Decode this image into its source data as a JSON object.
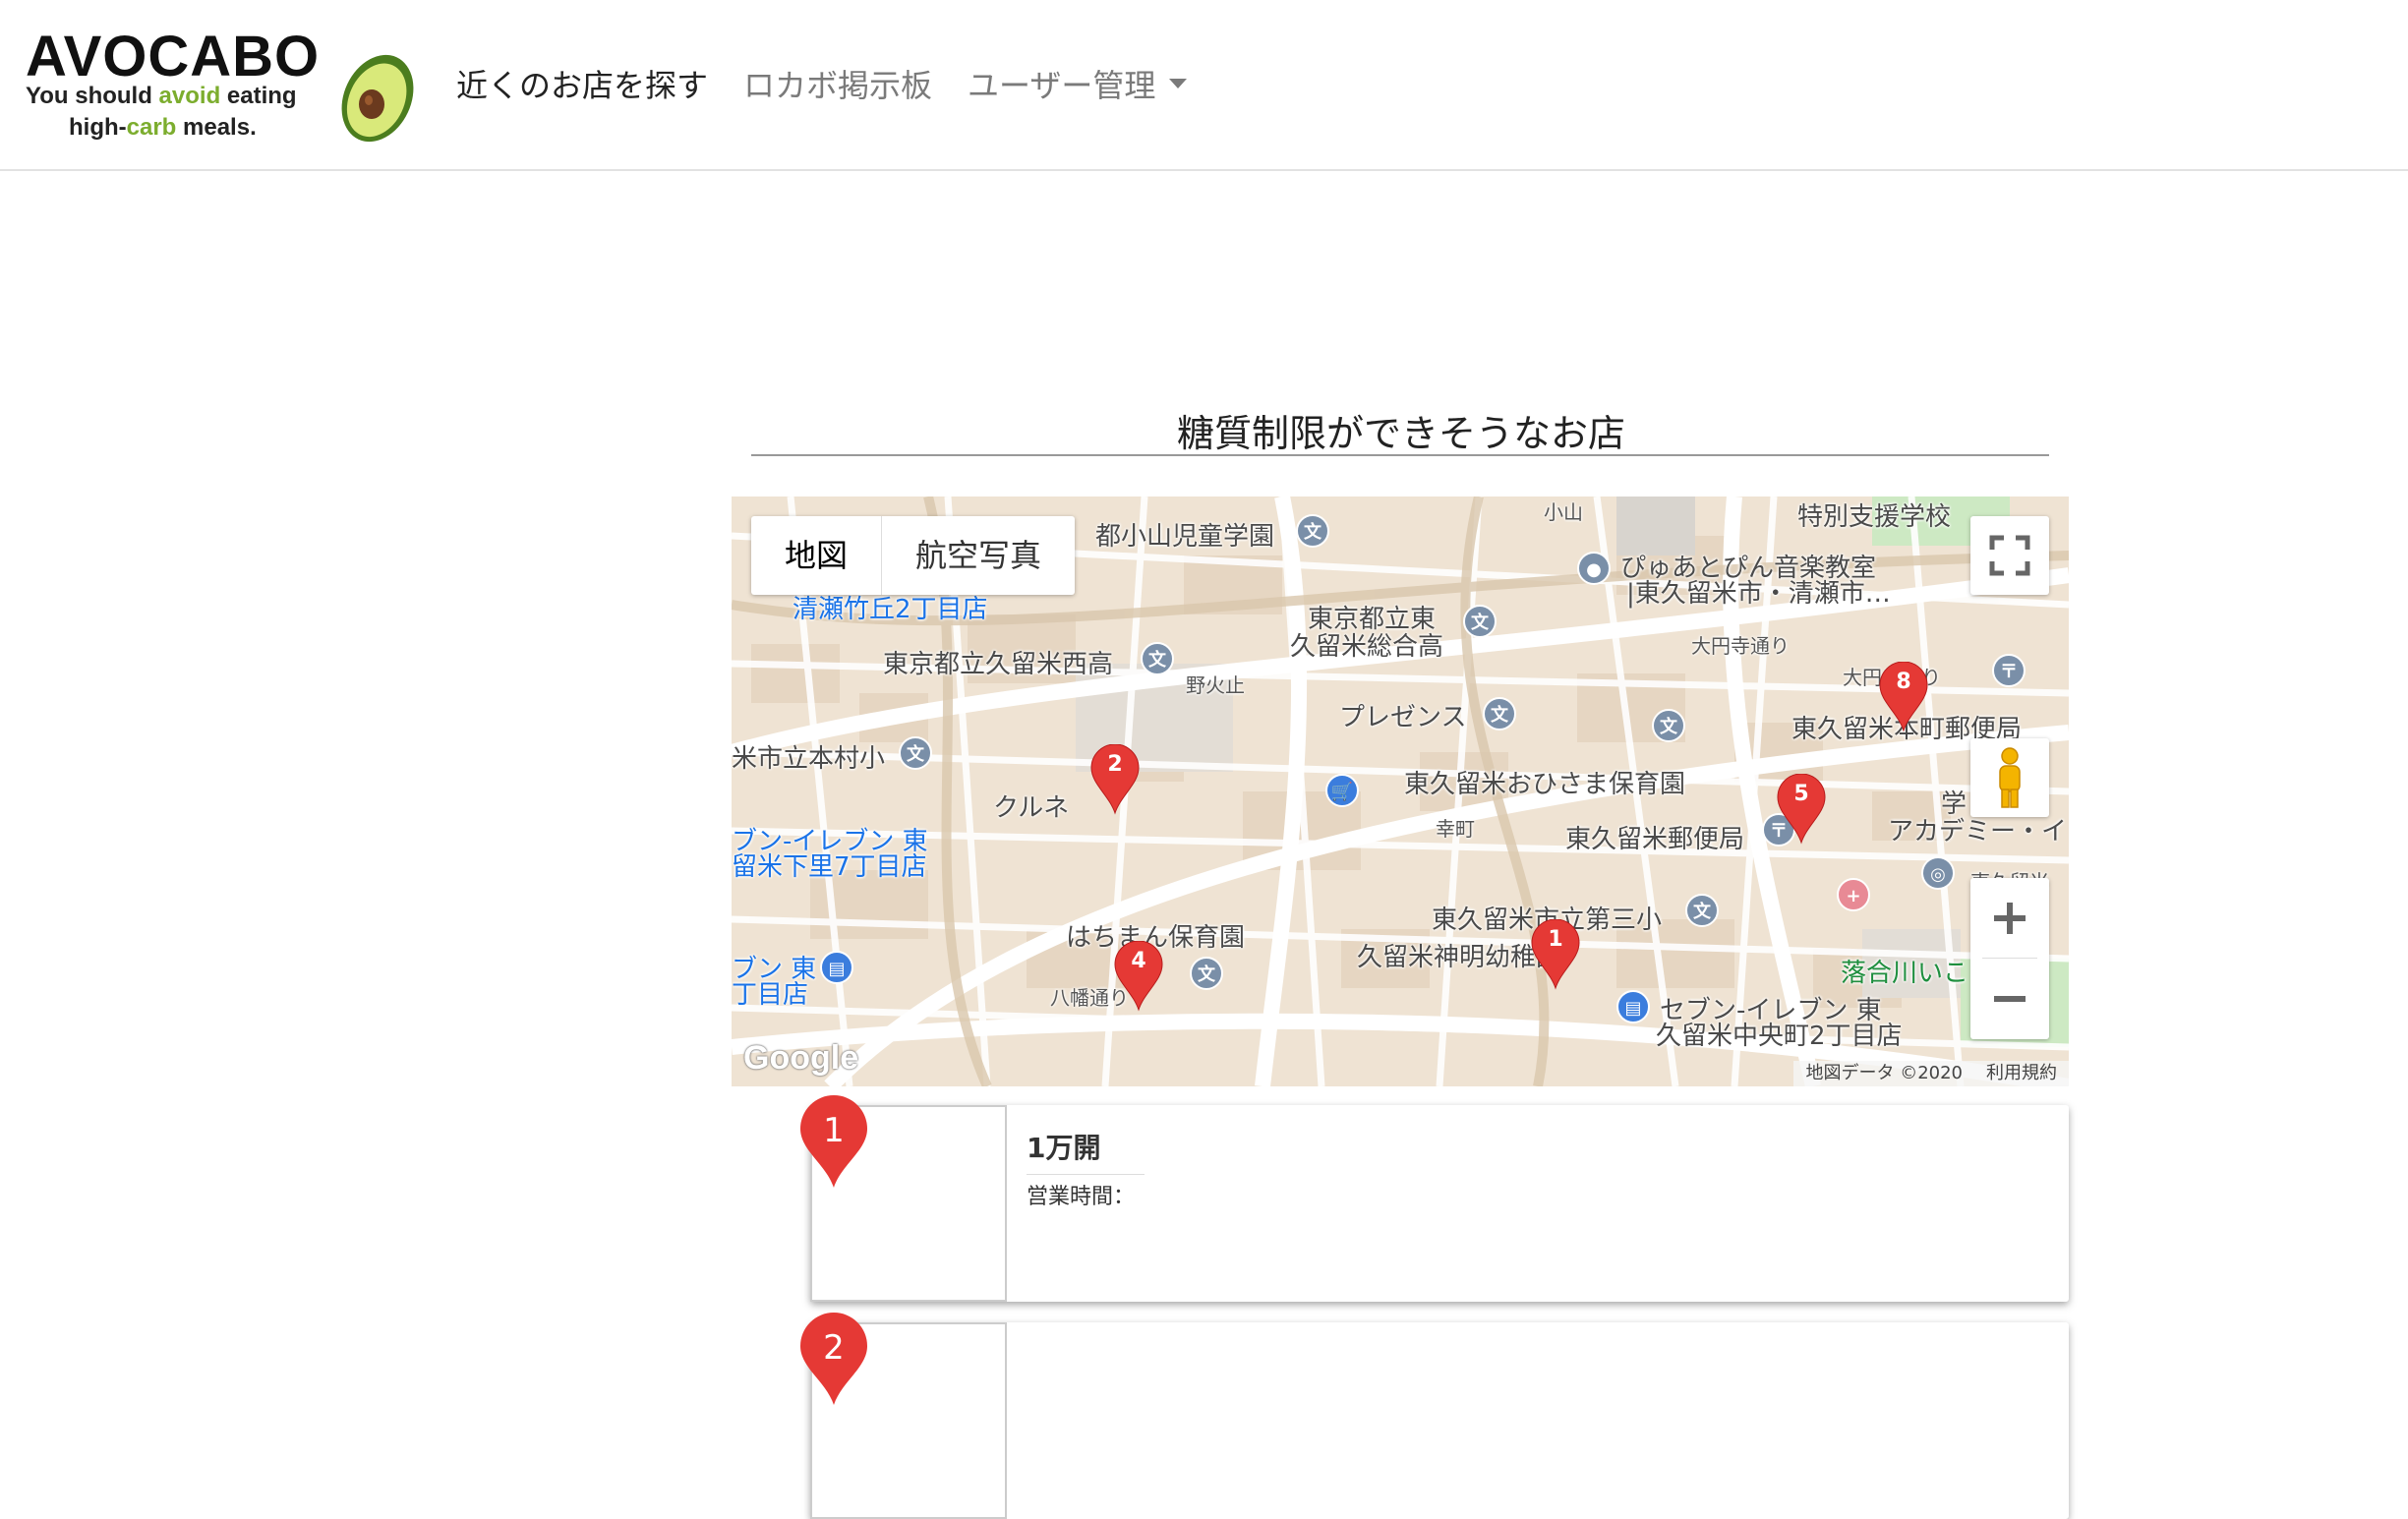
{
  "logo": {
    "title": "AVOCABO",
    "tagline_part1": "You should ",
    "tagline_highlight1": "avoid",
    "tagline_part2": " eating",
    "tagline_part3": "high-",
    "tagline_highlight2": "carb",
    "tagline_part4": " meals."
  },
  "nav": {
    "find_shops": "近くのお店を探す",
    "board": "ロカボ掲示板",
    "user_admin": "ユーザー管理"
  },
  "page": {
    "title": "糖質制限ができそうなお店"
  },
  "map": {
    "type_map": "地図",
    "type_satellite": "航空写真",
    "attribution": "地図データ ©2020",
    "terms": "利用規約",
    "google_logo": "Google",
    "labels": {
      "l1": "都小山児童学園",
      "l2": "清瀬竹丘2丁目店",
      "l3": "東京都立久留米西高",
      "l4": "東京都立東",
      "l5": "久留米総合高",
      "l6": "ぴゅあとぴん音楽教室",
      "l7": "|東久留米市・清瀬市…",
      "l8": "特別支援学校",
      "l9": "野火止",
      "l10": "プレゼンス",
      "l11": "大円寺通り",
      "l12": "東久留米本町郵便局",
      "l13": "米市立本村小",
      "l14": "クルネ",
      "l15": "東久留米おひさま保育園",
      "l16": "幸町",
      "l17": "東久留米郵便局",
      "l18": "アカデミー・イ",
      "l19": "ブン-イレブン 東",
      "l20": "留米下里7丁目店",
      "l21": "はちまん保育園",
      "l22": "東久留米市立第三小",
      "l23": "久留米神明幼稚園",
      "l24": "セブン-イレブン 東",
      "l25": "久留米中央町2丁目店",
      "l26": "落合川いこ",
      "l27": "ブン 東",
      "l28": "丁目店",
      "l29": "八幡通り",
      "l30": "小山",
      "l31": "大円寺通り",
      "l32": "東久留米",
      "l33": "学"
    },
    "markers": [
      "1",
      "2",
      "4",
      "5",
      "8"
    ]
  },
  "shops": [
    {
      "number": "1",
      "name": "1万開",
      "hours_label": "営業時間："
    },
    {
      "number": "2",
      "name": "",
      "hours_label": ""
    }
  ],
  "colors": {
    "marker_red": "#e53935",
    "map_background": "#efe3d3",
    "road": "#ffffff",
    "green_area": "#cde9c3",
    "accent_green": "#7cad2e"
  }
}
